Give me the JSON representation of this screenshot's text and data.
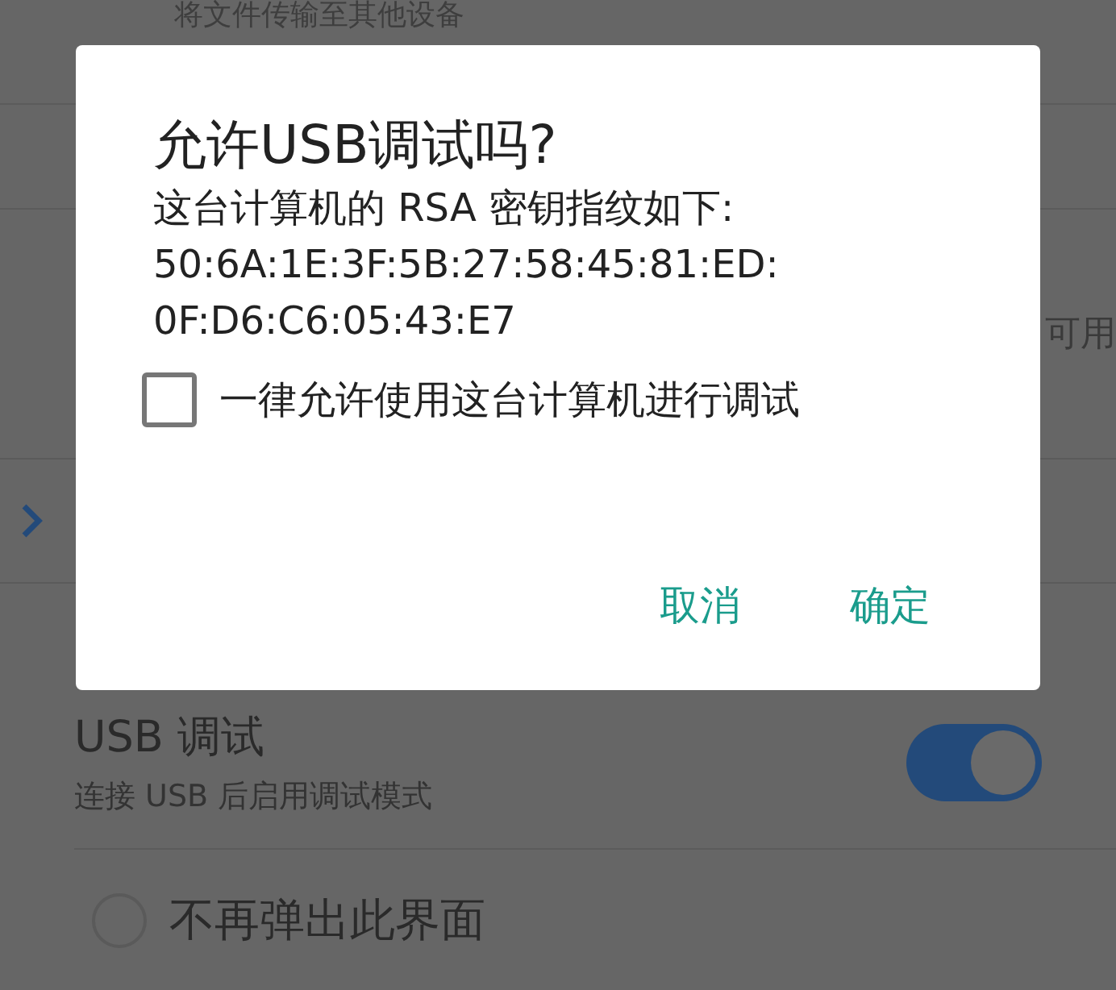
{
  "background": {
    "top_text": "将文件传输至其他设备",
    "side_text": "可用",
    "setting": {
      "title": "USB 调试",
      "subtitle": "连接 USB 后启用调试模式",
      "on": true
    },
    "option": {
      "label": "不再弹出此界面",
      "selected": false
    }
  },
  "dialog": {
    "title": "允许USB调试吗?",
    "message": [
      "这台计算机的 RSA 密钥指纹如下:",
      "50:6A:1E:3F:5B:27:58:45:81:ED:",
      "0F:D6:C6:05:43:E7"
    ],
    "checkbox": {
      "label": "一律允许使用这台计算机进行调试",
      "checked": false
    },
    "buttons": [
      "取消",
      "确定"
    ]
  }
}
